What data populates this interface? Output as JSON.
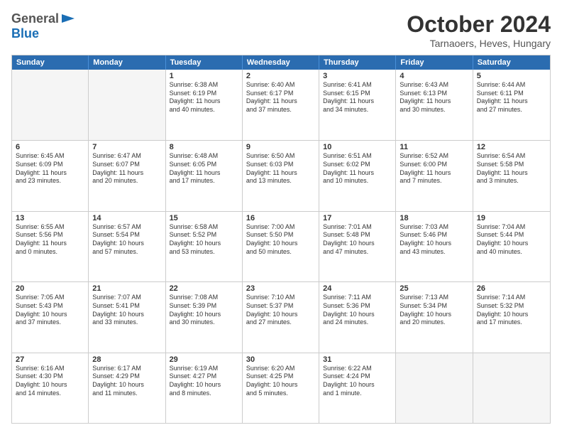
{
  "header": {
    "logo": {
      "general": "General",
      "blue": "Blue"
    },
    "title": "October 2024",
    "location": "Tarnaoers, Heves, Hungary"
  },
  "days_of_week": [
    "Sunday",
    "Monday",
    "Tuesday",
    "Wednesday",
    "Thursday",
    "Friday",
    "Saturday"
  ],
  "weeks": [
    [
      {
        "day": "",
        "empty": true
      },
      {
        "day": "",
        "empty": true
      },
      {
        "day": "1",
        "lines": [
          "Sunrise: 6:38 AM",
          "Sunset: 6:19 PM",
          "Daylight: 11 hours",
          "and 40 minutes."
        ]
      },
      {
        "day": "2",
        "lines": [
          "Sunrise: 6:40 AM",
          "Sunset: 6:17 PM",
          "Daylight: 11 hours",
          "and 37 minutes."
        ]
      },
      {
        "day": "3",
        "lines": [
          "Sunrise: 6:41 AM",
          "Sunset: 6:15 PM",
          "Daylight: 11 hours",
          "and 34 minutes."
        ]
      },
      {
        "day": "4",
        "lines": [
          "Sunrise: 6:43 AM",
          "Sunset: 6:13 PM",
          "Daylight: 11 hours",
          "and 30 minutes."
        ]
      },
      {
        "day": "5",
        "lines": [
          "Sunrise: 6:44 AM",
          "Sunset: 6:11 PM",
          "Daylight: 11 hours",
          "and 27 minutes."
        ]
      }
    ],
    [
      {
        "day": "6",
        "lines": [
          "Sunrise: 6:45 AM",
          "Sunset: 6:09 PM",
          "Daylight: 11 hours",
          "and 23 minutes."
        ]
      },
      {
        "day": "7",
        "lines": [
          "Sunrise: 6:47 AM",
          "Sunset: 6:07 PM",
          "Daylight: 11 hours",
          "and 20 minutes."
        ]
      },
      {
        "day": "8",
        "lines": [
          "Sunrise: 6:48 AM",
          "Sunset: 6:05 PM",
          "Daylight: 11 hours",
          "and 17 minutes."
        ]
      },
      {
        "day": "9",
        "lines": [
          "Sunrise: 6:50 AM",
          "Sunset: 6:03 PM",
          "Daylight: 11 hours",
          "and 13 minutes."
        ]
      },
      {
        "day": "10",
        "lines": [
          "Sunrise: 6:51 AM",
          "Sunset: 6:02 PM",
          "Daylight: 11 hours",
          "and 10 minutes."
        ]
      },
      {
        "day": "11",
        "lines": [
          "Sunrise: 6:52 AM",
          "Sunset: 6:00 PM",
          "Daylight: 11 hours",
          "and 7 minutes."
        ]
      },
      {
        "day": "12",
        "lines": [
          "Sunrise: 6:54 AM",
          "Sunset: 5:58 PM",
          "Daylight: 11 hours",
          "and 3 minutes."
        ]
      }
    ],
    [
      {
        "day": "13",
        "lines": [
          "Sunrise: 6:55 AM",
          "Sunset: 5:56 PM",
          "Daylight: 11 hours",
          "and 0 minutes."
        ]
      },
      {
        "day": "14",
        "lines": [
          "Sunrise: 6:57 AM",
          "Sunset: 5:54 PM",
          "Daylight: 10 hours",
          "and 57 minutes."
        ]
      },
      {
        "day": "15",
        "lines": [
          "Sunrise: 6:58 AM",
          "Sunset: 5:52 PM",
          "Daylight: 10 hours",
          "and 53 minutes."
        ]
      },
      {
        "day": "16",
        "lines": [
          "Sunrise: 7:00 AM",
          "Sunset: 5:50 PM",
          "Daylight: 10 hours",
          "and 50 minutes."
        ]
      },
      {
        "day": "17",
        "lines": [
          "Sunrise: 7:01 AM",
          "Sunset: 5:48 PM",
          "Daylight: 10 hours",
          "and 47 minutes."
        ]
      },
      {
        "day": "18",
        "lines": [
          "Sunrise: 7:03 AM",
          "Sunset: 5:46 PM",
          "Daylight: 10 hours",
          "and 43 minutes."
        ]
      },
      {
        "day": "19",
        "lines": [
          "Sunrise: 7:04 AM",
          "Sunset: 5:44 PM",
          "Daylight: 10 hours",
          "and 40 minutes."
        ]
      }
    ],
    [
      {
        "day": "20",
        "lines": [
          "Sunrise: 7:05 AM",
          "Sunset: 5:43 PM",
          "Daylight: 10 hours",
          "and 37 minutes."
        ]
      },
      {
        "day": "21",
        "lines": [
          "Sunrise: 7:07 AM",
          "Sunset: 5:41 PM",
          "Daylight: 10 hours",
          "and 33 minutes."
        ]
      },
      {
        "day": "22",
        "lines": [
          "Sunrise: 7:08 AM",
          "Sunset: 5:39 PM",
          "Daylight: 10 hours",
          "and 30 minutes."
        ]
      },
      {
        "day": "23",
        "lines": [
          "Sunrise: 7:10 AM",
          "Sunset: 5:37 PM",
          "Daylight: 10 hours",
          "and 27 minutes."
        ]
      },
      {
        "day": "24",
        "lines": [
          "Sunrise: 7:11 AM",
          "Sunset: 5:36 PM",
          "Daylight: 10 hours",
          "and 24 minutes."
        ]
      },
      {
        "day": "25",
        "lines": [
          "Sunrise: 7:13 AM",
          "Sunset: 5:34 PM",
          "Daylight: 10 hours",
          "and 20 minutes."
        ]
      },
      {
        "day": "26",
        "lines": [
          "Sunrise: 7:14 AM",
          "Sunset: 5:32 PM",
          "Daylight: 10 hours",
          "and 17 minutes."
        ]
      }
    ],
    [
      {
        "day": "27",
        "lines": [
          "Sunrise: 6:16 AM",
          "Sunset: 4:30 PM",
          "Daylight: 10 hours",
          "and 14 minutes."
        ]
      },
      {
        "day": "28",
        "lines": [
          "Sunrise: 6:17 AM",
          "Sunset: 4:29 PM",
          "Daylight: 10 hours",
          "and 11 minutes."
        ]
      },
      {
        "day": "29",
        "lines": [
          "Sunrise: 6:19 AM",
          "Sunset: 4:27 PM",
          "Daylight: 10 hours",
          "and 8 minutes."
        ]
      },
      {
        "day": "30",
        "lines": [
          "Sunrise: 6:20 AM",
          "Sunset: 4:25 PM",
          "Daylight: 10 hours",
          "and 5 minutes."
        ]
      },
      {
        "day": "31",
        "lines": [
          "Sunrise: 6:22 AM",
          "Sunset: 4:24 PM",
          "Daylight: 10 hours",
          "and 1 minute."
        ]
      },
      {
        "day": "",
        "empty": true
      },
      {
        "day": "",
        "empty": true
      }
    ]
  ]
}
